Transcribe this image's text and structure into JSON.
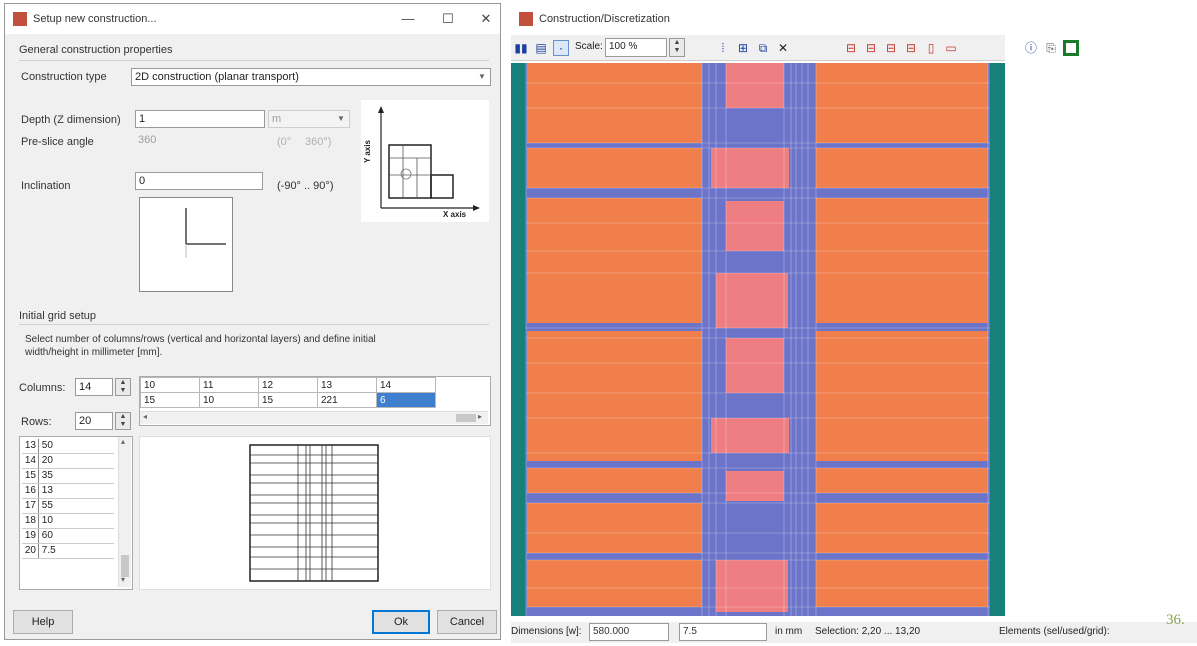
{
  "dialog": {
    "title": "Setup new construction...",
    "minimize_glyph": "—",
    "maximize_glyph": "☐",
    "close_glyph": "✕",
    "general_section": "General construction properties",
    "construction_type_label": "Construction type",
    "construction_type_value": "2D construction (planar transport)",
    "depth_label": "Depth (Z dimension)",
    "depth_value": "1",
    "depth_unit": "m",
    "pre_slice_label": "Pre-slice angle",
    "pre_slice_value": "360",
    "pre_slice_unit": "(0°",
    "pre_slice_range": "360°)",
    "inclination_label": "Inclination",
    "inclination_value": "0",
    "inclination_range": "(-90° .. 90°)",
    "axis_y_label": "Y axis",
    "axis_x_label": "X axis",
    "grid_section": "Initial grid setup",
    "grid_description_line1": "Select number of columns/rows (vertical and horizontal layers) and define initial",
    "grid_description_line2": "width/height in millimeter [mm].",
    "columns_label": "Columns:",
    "columns_value": "14",
    "rows_label": "Rows:",
    "rows_value": "20",
    "column_table": {
      "headers": [
        "10",
        "11",
        "12",
        "13",
        "14"
      ],
      "values": [
        "15",
        "10",
        "15",
        "221",
        "6"
      ]
    },
    "row_list": [
      {
        "num": "13",
        "value": "50"
      },
      {
        "num": "14",
        "value": "20"
      },
      {
        "num": "15",
        "value": "35"
      },
      {
        "num": "16",
        "value": "13"
      },
      {
        "num": "17",
        "value": "55"
      },
      {
        "num": "18",
        "value": "10"
      },
      {
        "num": "19",
        "value": "60"
      },
      {
        "num": "20",
        "value": "7.5"
      }
    ],
    "help_button": "Help",
    "ok_button": "Ok",
    "cancel_button": "Cancel"
  },
  "window": {
    "title": "Construction/Discretization",
    "scale_label": "Scale:",
    "scale_value": "100 %",
    "status": {
      "dimensions_label": "Dimensions [w]:",
      "dimensions_value": "580.000",
      "value_field": "7.5",
      "unit": "in mm",
      "selection": "Selection: 2,20 ... 13,20",
      "elements": "Elements (sel/used/grid):"
    }
  },
  "colors": {
    "orange": "#f07f4c",
    "blue": "#6b74c8",
    "pink": "#ee7e82",
    "teal": "#17807a",
    "accent": "#0078d7",
    "page_number": "#8aa04a"
  },
  "page_number": "36."
}
